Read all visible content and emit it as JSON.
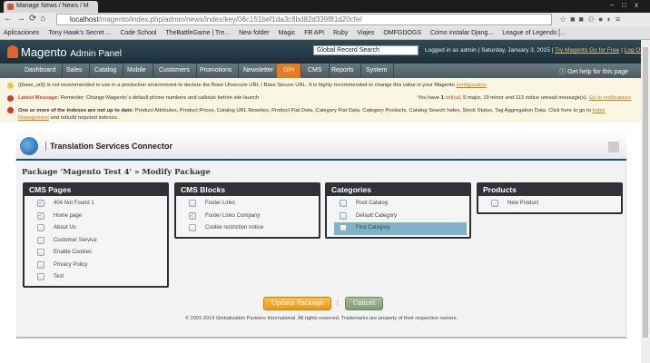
{
  "browser": {
    "tab_title": "Manage News / News / M",
    "url_host": "localhost",
    "url_path": "/magento/index.php/admin/news/index/key/06c151bef1da3c8bd82d339f81d20cfe/",
    "bookmarks": [
      "Aplicaciones",
      "Tony Hawk's Secret ...",
      "Code School",
      "TheBattleGame | Tre...",
      "New folder",
      "Magic",
      "FB API",
      "Ruby",
      "Viajes",
      "OMFGDOGS",
      "Cómo instalar Djang...",
      "League of Legends [..."
    ]
  },
  "header": {
    "logo": "Magento",
    "logo_sub": "Admin Panel",
    "search_value": "Global Record Search",
    "logged_in": "Logged in as admin",
    "date": "Saturday, January 3, 2015",
    "try_link": "Try Magento Go for Free",
    "logout": "Log Out"
  },
  "nav": {
    "items": [
      "Dashboard",
      "Sales",
      "Catalog",
      "Mobile",
      "Customers",
      "Promotions",
      "Newsletter",
      "GPI",
      "CMS",
      "Reports",
      "System"
    ],
    "active": "GPI",
    "help": "Get help for this page"
  },
  "messages": {
    "m1_text": "{{base_url}} is not recommended to use in a production environment to declare the Base Unsecure URL / Base Secure URL. It is highly recommended to change this value in your Magento ",
    "m1_link": "configuration",
    "m2_label": "Latest Message:",
    "m2_text": " Reminder: Change Magento`s default phone numbers and callouts before site launch",
    "m2_right_pre": "You have ",
    "m2_critical_n": "1",
    "m2_critical": "critical",
    "m2_rest": ", 5 major, 19 minor and 113 notice unread message(s). ",
    "m2_link": "Go to notifications",
    "m3_label": "One or more of the Indexes are not up to date:",
    "m3_text": " Product Attributes, Product Prices, Catalog URL Rewrites, Product Flat Data, Category Flat Data, Category Products, Catalog Search Index, Stock Status, Tag Aggregation Data. Click here to go to ",
    "m3_link": "Index Management",
    "m3_tail": " and rebuild required indexes."
  },
  "plugin": {
    "title": "Translation Services Connector",
    "page_title": "Package 'Magento Test 4' » Modify Package",
    "boxes": [
      {
        "title": "CMS Pages",
        "items": [
          {
            "label": "404 Not Found 1",
            "checked": true
          },
          {
            "label": "Home page",
            "checked": true
          },
          {
            "label": "About Us",
            "checked": false
          },
          {
            "label": "Customer Service",
            "checked": false
          },
          {
            "label": "Enable Cookies",
            "checked": false
          },
          {
            "label": "Privacy Policy",
            "checked": false
          },
          {
            "label": "Test",
            "checked": false
          }
        ]
      },
      {
        "title": "CMS Blocks",
        "items": [
          {
            "label": "Footer Links",
            "checked": false
          },
          {
            "label": "Footer Links Company",
            "checked": true
          },
          {
            "label": "Cookie restriction notice",
            "checked": false
          }
        ]
      },
      {
        "title": "Categories",
        "items": [
          {
            "label": "Root Catalog",
            "checked": false
          },
          {
            "label": "Default Category",
            "checked": false
          },
          {
            "label": "First Category",
            "checked": false,
            "selected": true
          }
        ]
      },
      {
        "title": "Products",
        "items": [
          {
            "label": "New Product",
            "checked": false
          }
        ]
      }
    ],
    "update_button": "Update Package",
    "separator": "|",
    "cancel_button": "Cancel",
    "copyright": "© 2001-2014 Globalization Partners International. All rights reserved. Trademarks are property of their respective owners."
  }
}
